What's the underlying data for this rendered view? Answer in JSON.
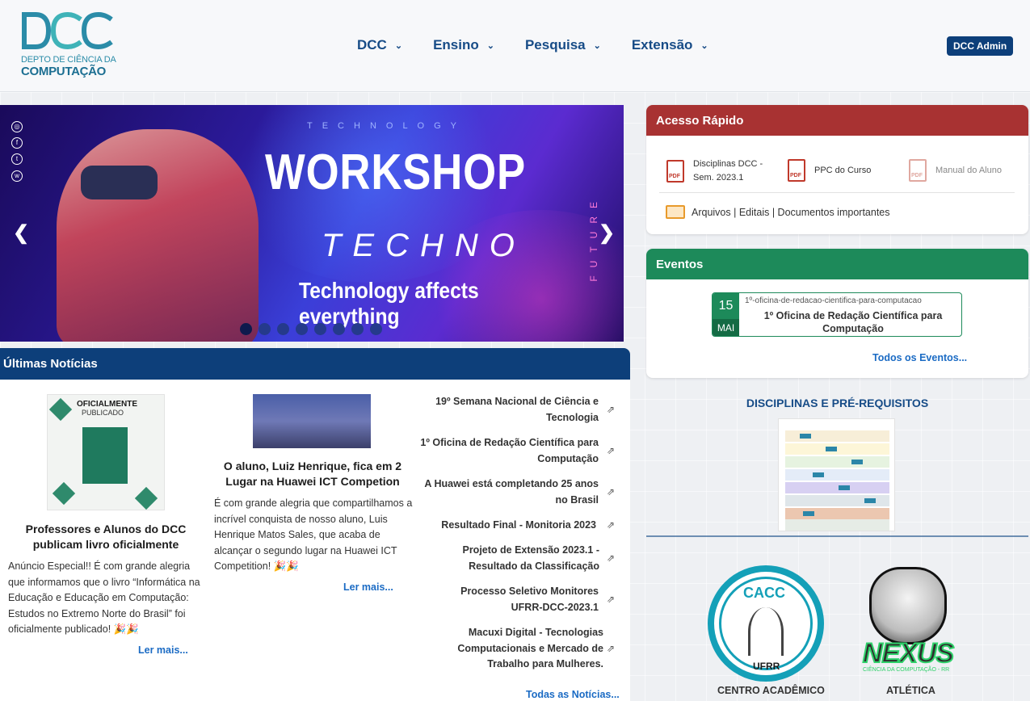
{
  "header": {
    "logo_mark": "DCC",
    "logo_line1": "DEPTO DE CIÊNCIA DA",
    "logo_line2": "COMPUTAÇÃO",
    "nav": [
      {
        "label": "DCC"
      },
      {
        "label": "Ensino"
      },
      {
        "label": "Pesquisa"
      },
      {
        "label": "Extensão"
      }
    ],
    "admin_label": "DCC Admin"
  },
  "banner": {
    "tech": "TECHNOLOGY",
    "title": "WORKSHOP",
    "subtitle": "TECHNO",
    "tagline": "Technology affects everything",
    "future": "FUTURE",
    "prev": "❮",
    "next": "❯",
    "slide_count": 8,
    "active_slide": 1
  },
  "news": {
    "header": "Últimas Notícias",
    "card1": {
      "img_title": "OFICIALMENTE",
      "img_sub": "PUBLICADO",
      "title": "Professores e Alunos do DCC publicam livro oficialmente",
      "text": "Anúncio Especial!! É com grande alegria que informamos que o livro “Informática na Educação e Educação em Computação: Estudos no Extremo Norte do Brasil” foi oficialmente publicado! 🎉🎉",
      "more": "Ler mais..."
    },
    "card2": {
      "title": "O aluno, Luiz Henrique, fica em 2 Lugar na Huawei ICT Competion",
      "text": "É com grande alegria que compartilhamos a incrível conquista de nosso aluno, Luis Henrique Matos Sales, que acaba de alcançar o segundo lugar na Huawei ICT Competition! 🎉🎉",
      "more": "Ler mais..."
    },
    "links": [
      "19º Semana Nacional de Ciência e Tecnologia",
      "1º Oficina de Redação Científica para Computação",
      "A Huawei está completando 25 anos no Brasil",
      "Resultado Final - Monitoria 2023",
      "Projeto de Extensão 2023.1 - Resultado da Classificação",
      "Processo Seletivo Monitores UFRR-DCC-2023.1",
      "Macuxi Digital - Tecnologias Computacionais e Mercado de Trabalho para Mulheres."
    ],
    "all": "Todas as Notícias..."
  },
  "quick_access": {
    "header": "Acesso Rápido",
    "header_color": "#a83232",
    "items": [
      {
        "label": "Disciplinas DCC - Sem. 2023.1",
        "icon": "pdf-icon"
      },
      {
        "label": "PPC do Curso",
        "icon": "pdf-icon"
      },
      {
        "label": "Manual do Aluno",
        "icon": "pdf-icon"
      }
    ],
    "pdf_tag": "PDF",
    "links_text": "Arquivos | Editais | Documentos importantes"
  },
  "events": {
    "header": "Eventos",
    "header_color": "#1d8a5a",
    "item": {
      "day": "15",
      "month": "MAI",
      "slug": "1º-oficina-de-redacao-cientifica-para-computacao",
      "title": "1º Oficina de Redação Científica para Computação"
    },
    "all": "Todos os Eventos..."
  },
  "disciplines": {
    "title": "DISCIPLINAS E PRÉ-REQUISITOS"
  },
  "orgs": [
    {
      "name": "CENTRO ACADÊMICO",
      "logo_text": "CACC",
      "logo_sub": "UFRR"
    },
    {
      "name": "ATLÉTICA",
      "logo_text": "NEXUS",
      "logo_sub": "CIÊNCIA DA COMPUTAÇÃO - RR"
    }
  ]
}
